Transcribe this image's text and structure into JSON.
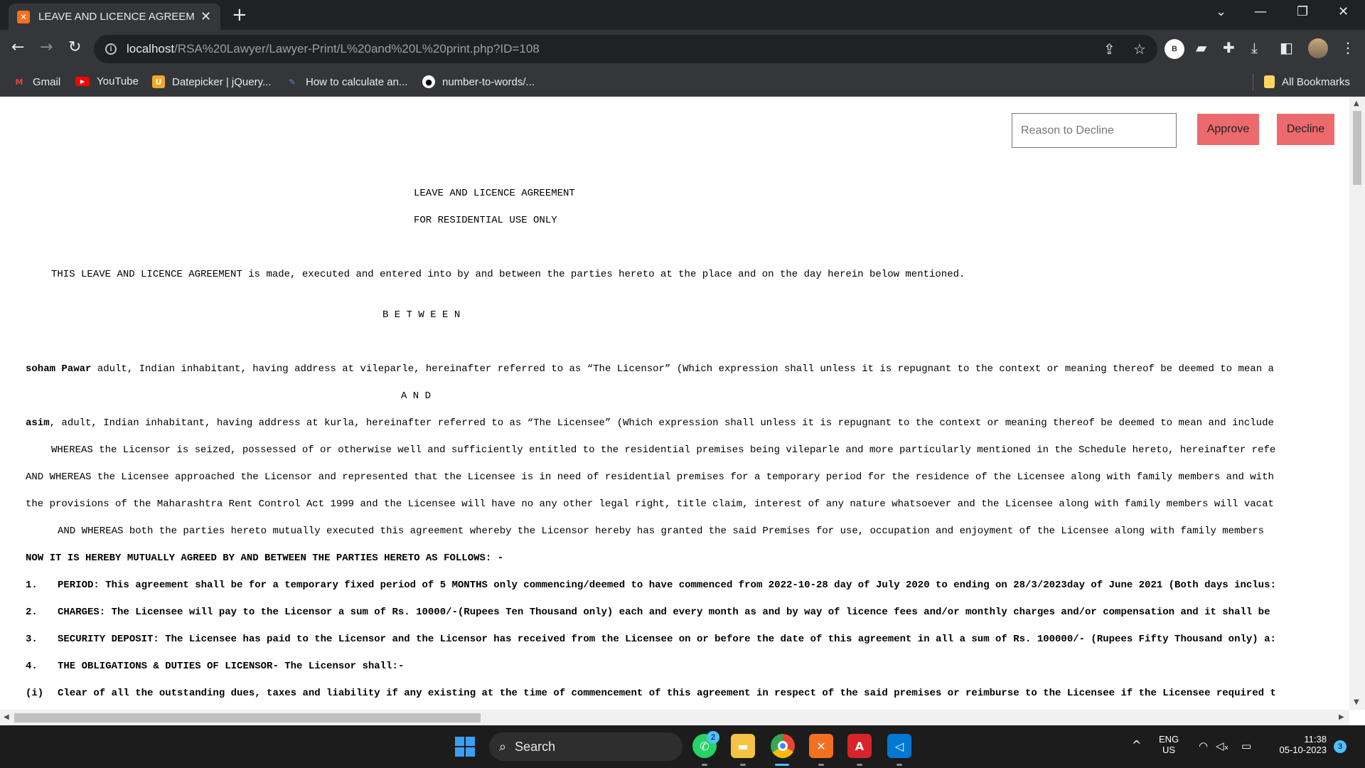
{
  "browser": {
    "tab_title": "LEAVE AND LICENCE AGREEMENT",
    "tab_favicon": "xampp-icon",
    "url_host": "localhost",
    "url_path": "/RSA%20Lawyer/Lawyer-Print/L%20and%20L%20print.php?ID=108",
    "profile_initial": "B",
    "bookmarks": [
      "Gmail",
      "YouTube",
      "Datepicker | jQuery...",
      "How to calculate an...",
      "number-to-words/..."
    ],
    "all_bookmarks": "All Bookmarks"
  },
  "actions": {
    "decline_placeholder": "Reason to Decline",
    "approve_label": "Approve",
    "decline_label": "Decline"
  },
  "document": {
    "title": "LEAVE AND LICENCE AGREEMENT",
    "subtitle": "FOR RESIDENTIAL USE ONLY",
    "intro": "THIS LEAVE AND LICENCE AGREEMENT is made, executed and entered into by and between the parties hereto at the place and on the day herein below mentioned.",
    "between": "B E T W E E N",
    "licensor_name": "soham Pawar",
    "licensor_text": " adult, Indian inhabitant, having address at vileparle, hereinafter referred to as “The Licensor” (Which expression shall unless it is repugnant to the context or meaning thereof be deemed to mean a",
    "and": "A N D",
    "licensee_name": "asim",
    "licensee_text": ", adult, Indian inhabitant, having address at kurla, hereinafter referred to as “The Licensee” (Which expression shall unless it is repugnant to the context or meaning thereof be deemed to mean and include",
    "whereas1": "WHEREAS the Licensor is seized, possessed of or otherwise well and sufficiently entitled to the residential premises being vileparle and more particularly mentioned in the Schedule hereto, hereinafter refe",
    "whereas2": "AND WHEREAS the Licensee approached the Licensor and represented that the Licensee is in need of residential premises for a temporary period for the residence of the Licensee along with family members and with",
    "whereas2b": "the provisions of the Maharashtra Rent Control Act 1999 and the Licensee will have no any other legal right, title claim, interest of any nature whatsoever and the Licensee along with family members will vacat",
    "whereas3": "AND WHEREAS both the parties hereto mutually executed this agreement whereby the Licensor hereby has granted the said Premises for use, occupation and enjoyment of the Licensee along with family members",
    "now_agreed": "NOW IT IS HEREBY MUTUALLY AGREED BY AND BETWEEN THE PARTIES HERETO AS FOLLOWS: -",
    "clauses": [
      {
        "num": "1.",
        "text": "PERIOD: This agreement shall be for a temporary fixed period of 5 MONTHS only commencing/deemed to have commenced from 2022-10-28 day of July 2020 to ending on 28/3/2023day of June 2021 (Both days inclus:"
      },
      {
        "num": "2.",
        "text": "CHARGES: The Licensee will pay to the Licensor a sum of Rs. 10000/-(Rupees Ten Thousand only) each and every month as and by way of licence fees and/or monthly charges and/or compensation and it shall be"
      },
      {
        "num": "3.",
        "text": "SECURITY DEPOSIT: The Licensee has paid to the Licensor and the Licensor has received from the Licensee on or before the date of this agreement in all a sum of Rs. 100000/- (Rupees Fifty Thousand only) a:"
      },
      {
        "num": "4.",
        "text": "THE OBLIGATIONS & DUTIES OF LICENSOR- The Licensor shall:-"
      },
      {
        "num": "(i)",
        "text": "Clear of all the outstanding dues, taxes and liability if any existing at the time of commencement of this agreement in respect of the said premises or reimburse to the Licensee if the Licensee required t"
      }
    ]
  },
  "taskbar": {
    "search_label": "Search",
    "whatsapp_badge": "2",
    "lang_line1": "ENG",
    "lang_line2": "US",
    "time": "11:38",
    "date": "05-10-2023",
    "notification_count": "3"
  },
  "colors": {
    "action_button": "#ec6a6e",
    "chrome_dark": "#202124",
    "chrome_toolbar": "#35363a"
  }
}
